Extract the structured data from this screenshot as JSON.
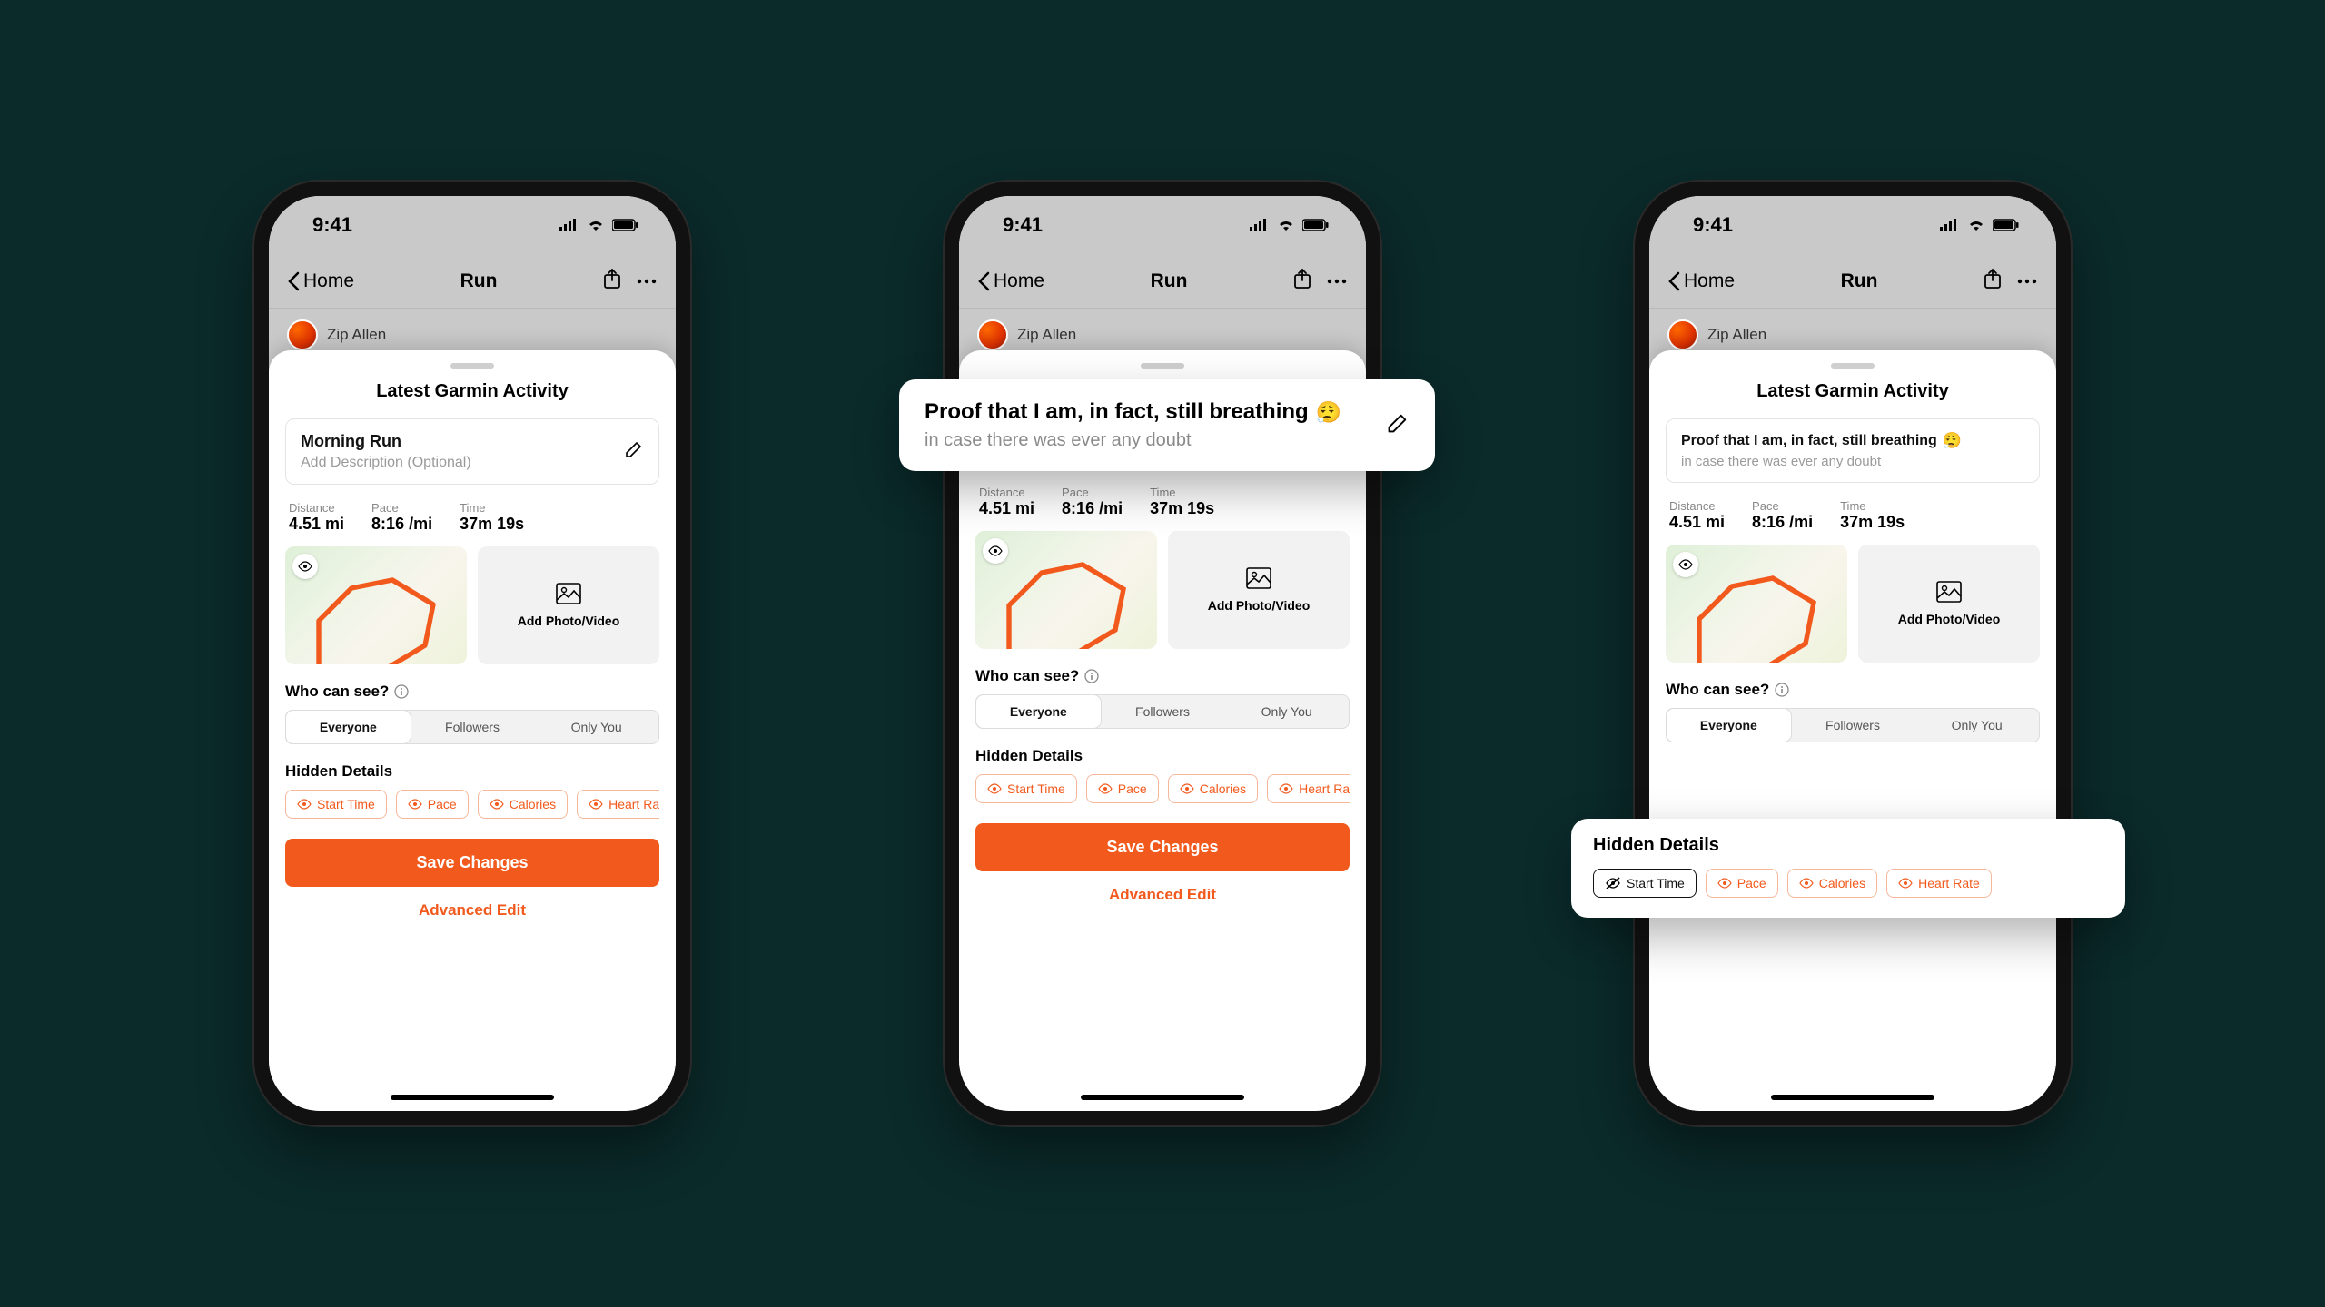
{
  "status": {
    "time": "9:41"
  },
  "nav": {
    "back": "Home",
    "title": "Run"
  },
  "user": {
    "name": "Zip Allen"
  },
  "sheet": {
    "title": "Latest Garmin Activity",
    "activity_title": "Morning Run",
    "desc_placeholder": "Add Description (Optional)",
    "edited_title": "Proof that I am, in fact, still breathing",
    "edited_desc": "in case there was ever any doubt",
    "emoji": "😮‍💨"
  },
  "stats": {
    "distance": {
      "label": "Distance",
      "value": "4.51 mi"
    },
    "pace": {
      "label": "Pace",
      "value": "8:16 /mi"
    },
    "time": {
      "label": "Time",
      "value": "37m 19s"
    }
  },
  "media": {
    "add": "Add Photo/Video"
  },
  "visibility": {
    "label": "Who can see?",
    "options": [
      "Everyone",
      "Followers",
      "Only You"
    ]
  },
  "hidden": {
    "label": "Hidden Details",
    "chips": [
      "Start Time",
      "Pace",
      "Calories",
      "Heart Rate"
    ]
  },
  "actions": {
    "save": "Save Changes",
    "advanced": "Advanced Edit"
  }
}
